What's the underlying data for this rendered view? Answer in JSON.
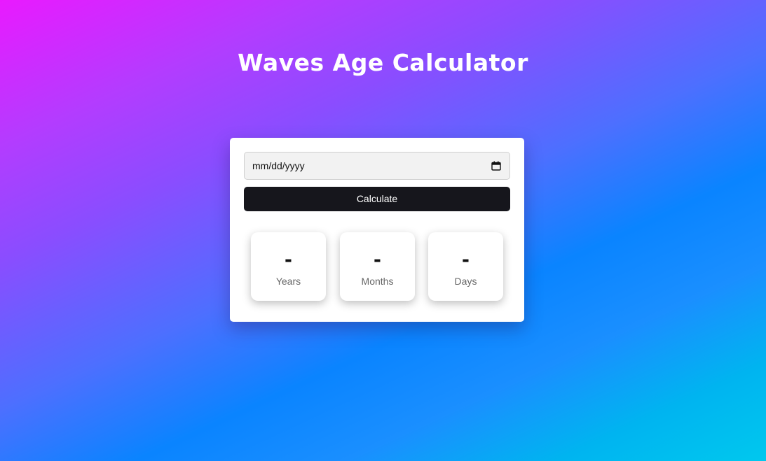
{
  "header": {
    "title": "Waves Age Calculator"
  },
  "form": {
    "date_placeholder": "mm/dd/yyyy",
    "calculate_label": "Calculate"
  },
  "results": [
    {
      "value": "-",
      "label": "Years"
    },
    {
      "value": "-",
      "label": "Months"
    },
    {
      "value": "-",
      "label": "Days"
    }
  ],
  "colors": {
    "gradient_start": "#e91aff",
    "gradient_mid": "#0a84ff",
    "gradient_end": "#00c8ee",
    "button_bg": "#16161c",
    "card_bg": "#ffffff"
  },
  "icons": {
    "date_picker": "calendar-icon"
  }
}
